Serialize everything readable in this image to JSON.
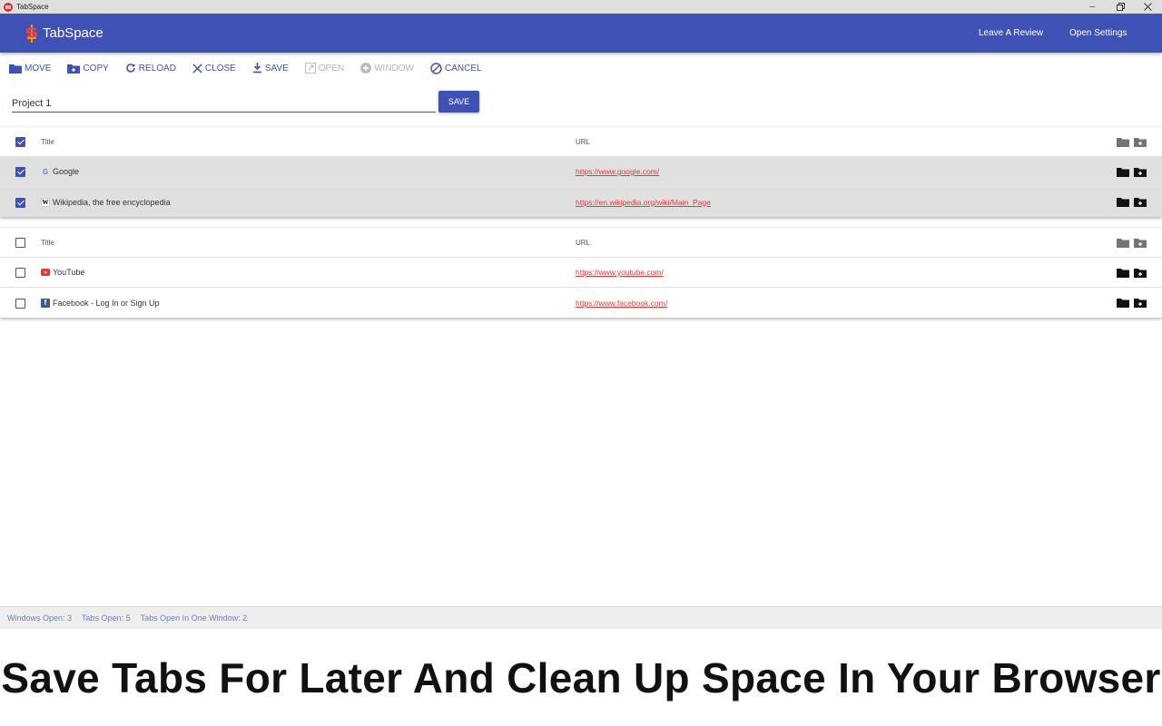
{
  "window": {
    "title": "TabSpace",
    "controls": [
      "minimize",
      "restore",
      "close"
    ]
  },
  "appbar": {
    "brand": "TabSpace",
    "leave_review": "Leave A Review",
    "open_settings": "Open Settings",
    "color": "#3f51b5"
  },
  "toolbar": {
    "move": "MOVE",
    "copy": "COPY",
    "reload": "RELOAD",
    "close": "CLOSE",
    "save": "SAVE",
    "open": "OPEN",
    "window": "WINDOW",
    "cancel": "CANCEL"
  },
  "name_field": {
    "value": "Project 1"
  },
  "save_button": "SAVE",
  "groups": [
    {
      "header": {
        "title": "Title",
        "url": "URL",
        "checked": true
      },
      "rows": [
        {
          "title": "Google",
          "url": "https://www.google.com/",
          "icon": "google-favicon",
          "checked": true
        },
        {
          "title": "Wikipedia, the free encyclopedia",
          "url": "https://en.wikipedia.org/wiki/Main_Page",
          "icon": "wikipedia-favicon",
          "checked": true
        }
      ]
    },
    {
      "header": {
        "title": "Title",
        "url": "URL",
        "checked": false
      },
      "rows": [
        {
          "title": "YouTube",
          "url": "https://www.youtube.com/",
          "icon": "youtube-favicon",
          "checked": false
        },
        {
          "title": "Facebook - Log In or Sign Up",
          "url": "https://www.facebook.com/",
          "icon": "facebook-favicon",
          "checked": false
        }
      ]
    }
  ],
  "status": {
    "windows_open": "Windows Open: 3",
    "tabs_open": "Tabs Open: 5",
    "tabs_one_window": "Tabs Open In One Window: 2"
  },
  "tagline": "Save Tabs For Later And Clean Up Space In Your Browser"
}
